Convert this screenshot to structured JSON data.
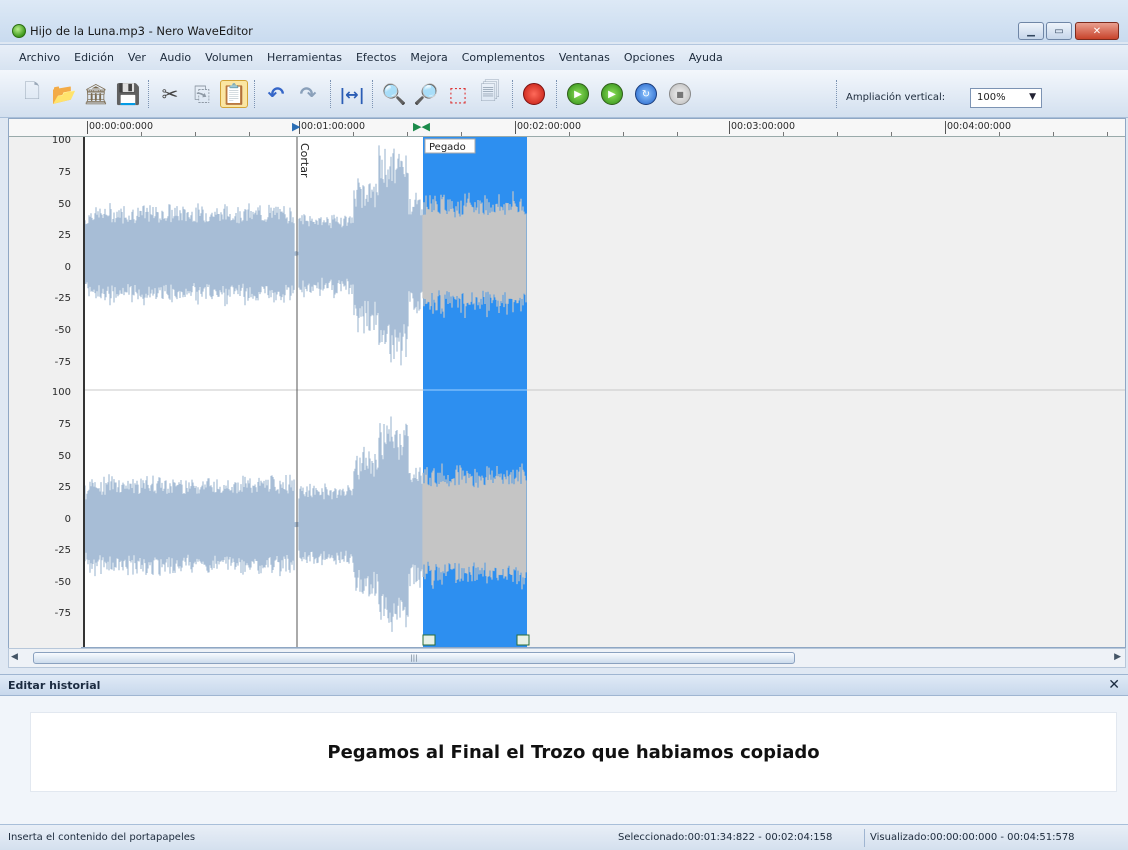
{
  "window": {
    "title": "Hijo de la Luna.mp3 - Nero WaveEditor",
    "controls": [
      "minimize",
      "maximize",
      "close"
    ]
  },
  "menu": [
    "Archivo",
    "Edición",
    "Ver",
    "Audio",
    "Volumen",
    "Herramientas",
    "Efectos",
    "Mejora",
    "Complementos",
    "Ventanas",
    "Opciones",
    "Ayuda"
  ],
  "toolbar": {
    "icons": [
      "new-file-icon",
      "open-folder-icon",
      "library-icon",
      "save-icon",
      "cut-icon",
      "copy-icon",
      "paste-icon",
      "undo-icon",
      "redo-icon",
      "fit-width-icon",
      "zoom-in-icon",
      "zoom-out-icon",
      "zoom-selection-icon",
      "zoom-page-icon",
      "record-icon",
      "play-icon",
      "play-selection-icon",
      "loop-icon",
      "stop-icon"
    ],
    "zoom_label": "Ampliación vertical:",
    "zoom_value": "100%"
  },
  "waveform": {
    "timeline": [
      "00:00:00:000",
      "00:01:00:000",
      "00:02:00:000",
      "00:03:00:000",
      "00:04:00:000"
    ],
    "y_labels": [
      "100",
      "75",
      "50",
      "25",
      "0",
      "-25",
      "-50",
      "-75"
    ],
    "markers": [
      "Cortar"
    ],
    "selection_label": "Pegado",
    "colors": {
      "wave": "#a7bdd6",
      "selection": "#2d8ff0",
      "selected_wave": "#c5c5c5",
      "background": "#f0f0f0",
      "audio_area": "#ffffff"
    }
  },
  "history": {
    "title": "Editar historial",
    "entry": "Pegamos al Final el Trozo que habiamos copiado"
  },
  "status": {
    "left": "Inserta el contenido del portapapeles",
    "selected": "Seleccionado:00:01:34:822 - 00:02:04:158",
    "visible": "Visualizado:00:00:00:000 - 00:04:51:578"
  }
}
